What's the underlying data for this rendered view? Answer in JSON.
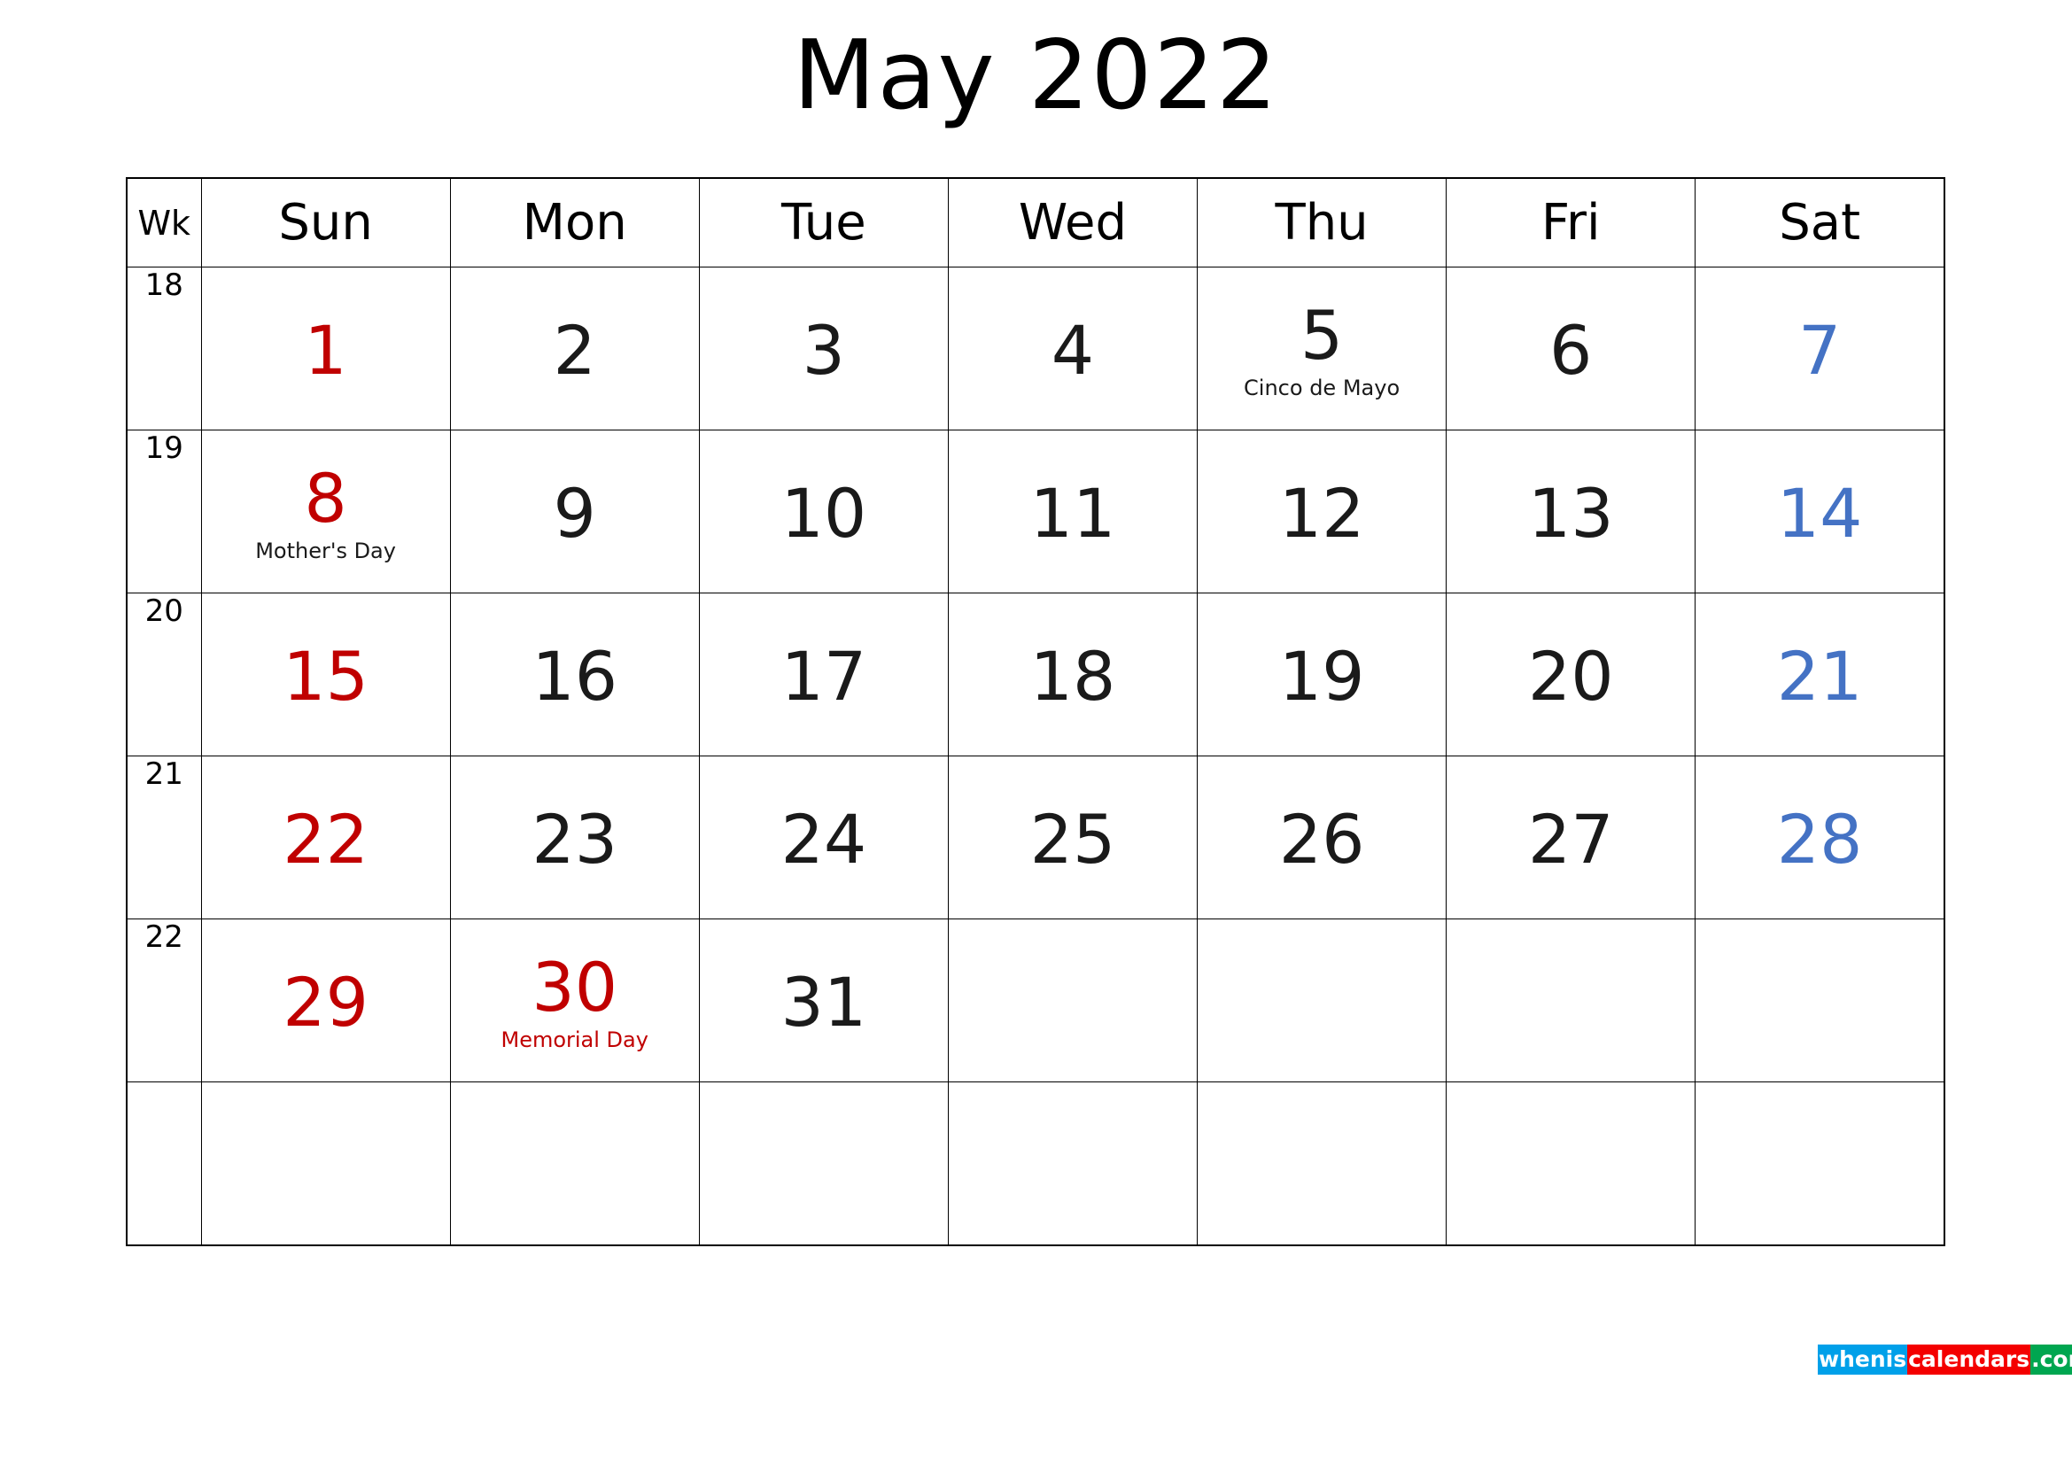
{
  "title": "May 2022",
  "headers": {
    "week": "Wk",
    "days": [
      "Sun",
      "Mon",
      "Tue",
      "Wed",
      "Thu",
      "Fri",
      "Sat"
    ]
  },
  "colors": {
    "sunday": "#C00000",
    "saturday": "#4472C4",
    "weekday": "#1a1a1a",
    "holiday_red": "#C00000",
    "grid_line": "#000000",
    "logo_blue": "#00A0E9",
    "logo_red": "#F40000",
    "logo_green": "#00A650"
  },
  "weeks": [
    {
      "wk": "18",
      "days": [
        {
          "num": "1",
          "color": "red",
          "note": "",
          "note_color": "black"
        },
        {
          "num": "2",
          "color": "black",
          "note": "",
          "note_color": "black"
        },
        {
          "num": "3",
          "color": "black",
          "note": "",
          "note_color": "black"
        },
        {
          "num": "4",
          "color": "black",
          "note": "",
          "note_color": "black"
        },
        {
          "num": "5",
          "color": "black",
          "note": "Cinco de Mayo",
          "note_color": "black"
        },
        {
          "num": "6",
          "color": "black",
          "note": "",
          "note_color": "black"
        },
        {
          "num": "7",
          "color": "blue",
          "note": "",
          "note_color": "black"
        }
      ]
    },
    {
      "wk": "19",
      "days": [
        {
          "num": "8",
          "color": "red",
          "note": "Mother's Day",
          "note_color": "black"
        },
        {
          "num": "9",
          "color": "black",
          "note": "",
          "note_color": "black"
        },
        {
          "num": "10",
          "color": "black",
          "note": "",
          "note_color": "black"
        },
        {
          "num": "11",
          "color": "black",
          "note": "",
          "note_color": "black"
        },
        {
          "num": "12",
          "color": "black",
          "note": "",
          "note_color": "black"
        },
        {
          "num": "13",
          "color": "black",
          "note": "",
          "note_color": "black"
        },
        {
          "num": "14",
          "color": "blue",
          "note": "",
          "note_color": "black"
        }
      ]
    },
    {
      "wk": "20",
      "days": [
        {
          "num": "15",
          "color": "red",
          "note": "",
          "note_color": "black"
        },
        {
          "num": "16",
          "color": "black",
          "note": "",
          "note_color": "black"
        },
        {
          "num": "17",
          "color": "black",
          "note": "",
          "note_color": "black"
        },
        {
          "num": "18",
          "color": "black",
          "note": "",
          "note_color": "black"
        },
        {
          "num": "19",
          "color": "black",
          "note": "",
          "note_color": "black"
        },
        {
          "num": "20",
          "color": "black",
          "note": "",
          "note_color": "black"
        },
        {
          "num": "21",
          "color": "blue",
          "note": "",
          "note_color": "black"
        }
      ]
    },
    {
      "wk": "21",
      "days": [
        {
          "num": "22",
          "color": "red",
          "note": "",
          "note_color": "black"
        },
        {
          "num": "23",
          "color": "black",
          "note": "",
          "note_color": "black"
        },
        {
          "num": "24",
          "color": "black",
          "note": "",
          "note_color": "black"
        },
        {
          "num": "25",
          "color": "black",
          "note": "",
          "note_color": "black"
        },
        {
          "num": "26",
          "color": "black",
          "note": "",
          "note_color": "black"
        },
        {
          "num": "27",
          "color": "black",
          "note": "",
          "note_color": "black"
        },
        {
          "num": "28",
          "color": "blue",
          "note": "",
          "note_color": "black"
        }
      ]
    },
    {
      "wk": "22",
      "days": [
        {
          "num": "29",
          "color": "red",
          "note": "",
          "note_color": "black"
        },
        {
          "num": "30",
          "color": "red",
          "note": "Memorial Day",
          "note_color": "red"
        },
        {
          "num": "31",
          "color": "black",
          "note": "",
          "note_color": "black"
        },
        {
          "num": "",
          "color": "black",
          "note": "",
          "note_color": "black"
        },
        {
          "num": "",
          "color": "black",
          "note": "",
          "note_color": "black"
        },
        {
          "num": "",
          "color": "black",
          "note": "",
          "note_color": "black"
        },
        {
          "num": "",
          "color": "black",
          "note": "",
          "note_color": "black"
        }
      ]
    },
    {
      "wk": "",
      "days": [
        {
          "num": "",
          "color": "black",
          "note": "",
          "note_color": "black"
        },
        {
          "num": "",
          "color": "black",
          "note": "",
          "note_color": "black"
        },
        {
          "num": "",
          "color": "black",
          "note": "",
          "note_color": "black"
        },
        {
          "num": "",
          "color": "black",
          "note": "",
          "note_color": "black"
        },
        {
          "num": "",
          "color": "black",
          "note": "",
          "note_color": "black"
        },
        {
          "num": "",
          "color": "black",
          "note": "",
          "note_color": "black"
        },
        {
          "num": "",
          "color": "black",
          "note": "",
          "note_color": "black"
        }
      ]
    }
  ],
  "logo": {
    "part1": "whenis",
    "part2": "calendars",
    "part3": ".com"
  }
}
